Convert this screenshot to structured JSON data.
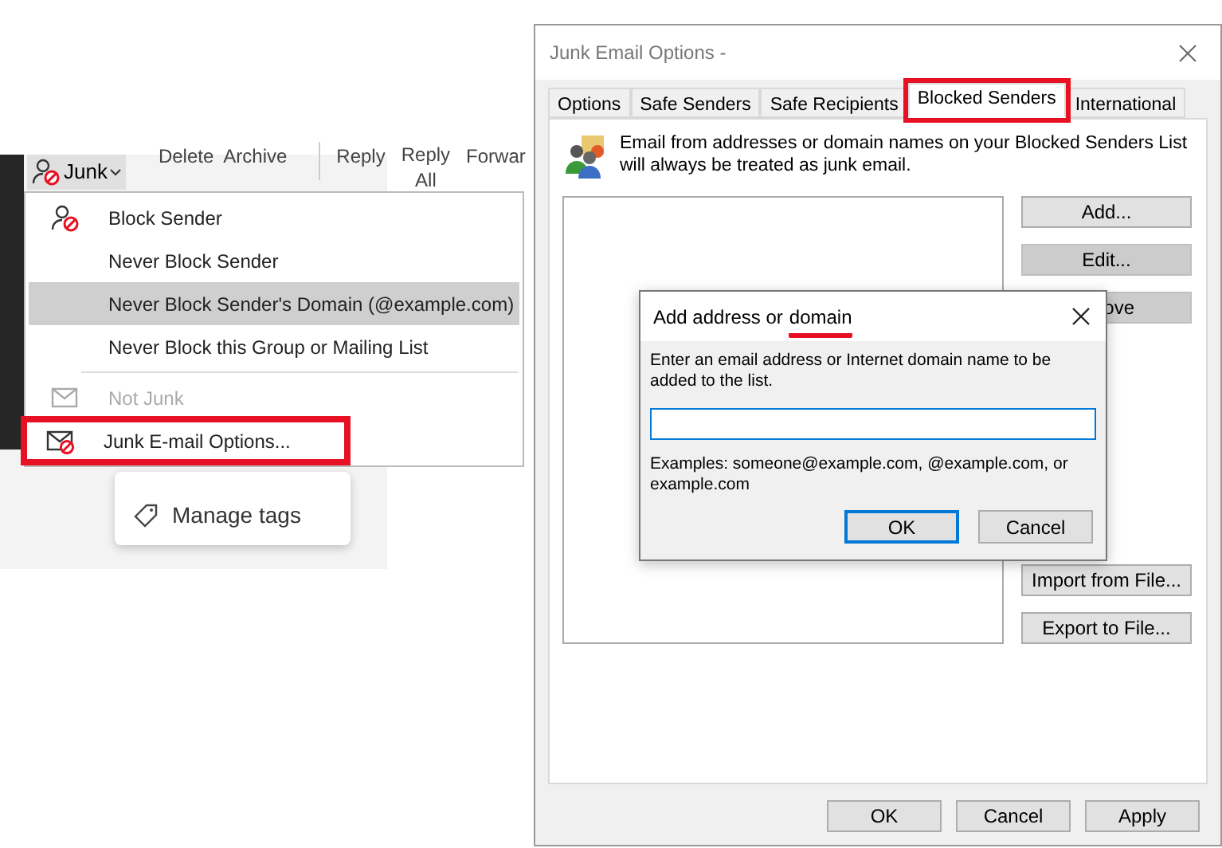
{
  "ribbon": {
    "junk_button": {
      "label": "Junk"
    },
    "commands": [
      "Delete",
      "Archive",
      "Reply",
      "Reply",
      "All",
      "Forwar"
    ]
  },
  "junk_menu": {
    "items": [
      {
        "label": "Block Sender",
        "kind": "blocked-user",
        "disabled": false,
        "selected": false,
        "highlighted": false
      },
      {
        "label": "Never Block Sender",
        "kind": "plain",
        "disabled": false,
        "selected": false,
        "highlighted": false
      },
      {
        "label": "Never Block Sender's Domain (@example.com)",
        "kind": "plain",
        "disabled": false,
        "selected": true,
        "highlighted": false
      },
      {
        "label": "Never Block this Group or Mailing List",
        "kind": "plain",
        "disabled": false,
        "selected": false,
        "highlighted": false
      },
      {
        "kind": "separator"
      },
      {
        "label": "Not Junk",
        "kind": "mail",
        "disabled": true,
        "selected": false,
        "highlighted": false
      },
      {
        "label": "Junk E-mail Options...",
        "kind": "blocked-mail",
        "disabled": false,
        "selected": false,
        "highlighted": true
      }
    ]
  },
  "tags_card": {
    "label": "Manage tags"
  },
  "junk_options_dialog": {
    "title": "Junk Email Options -",
    "tabs": [
      {
        "label": "Options",
        "selected": false,
        "highlighted": false
      },
      {
        "label": "Safe Senders",
        "selected": false,
        "highlighted": false
      },
      {
        "label": "Safe Recipients",
        "selected": false,
        "highlighted": false
      },
      {
        "label": "Blocked Senders",
        "selected": true,
        "highlighted": true
      },
      {
        "label": "International",
        "selected": false,
        "highlighted": false
      }
    ],
    "description": "Email from addresses or domain names on your Blocked Senders List will always be treated as junk email.",
    "side_buttons": [
      {
        "label": "Add...",
        "disabled": false
      },
      {
        "label": "Edit...",
        "disabled": true
      },
      {
        "label": "ove",
        "disabled": true
      }
    ],
    "file_buttons": [
      {
        "label": "Import from File...",
        "disabled": false
      },
      {
        "label": "Export to File...",
        "disabled": false
      }
    ],
    "footer_buttons": [
      {
        "label": "OK"
      },
      {
        "label": "Cancel"
      },
      {
        "label": "Apply"
      }
    ]
  },
  "add_dialog": {
    "title_parts": [
      {
        "text": "Add address or",
        "underlined": false
      },
      {
        "text": "domain",
        "underlined": true
      }
    ],
    "prompt": "Enter an email address or Internet domain name to be added to the list.",
    "examples": "Examples: someone@example.com, @example.com, or example.com",
    "buttons": [
      {
        "label": "OK",
        "default": true
      },
      {
        "label": "Cancel",
        "default": false
      }
    ]
  }
}
